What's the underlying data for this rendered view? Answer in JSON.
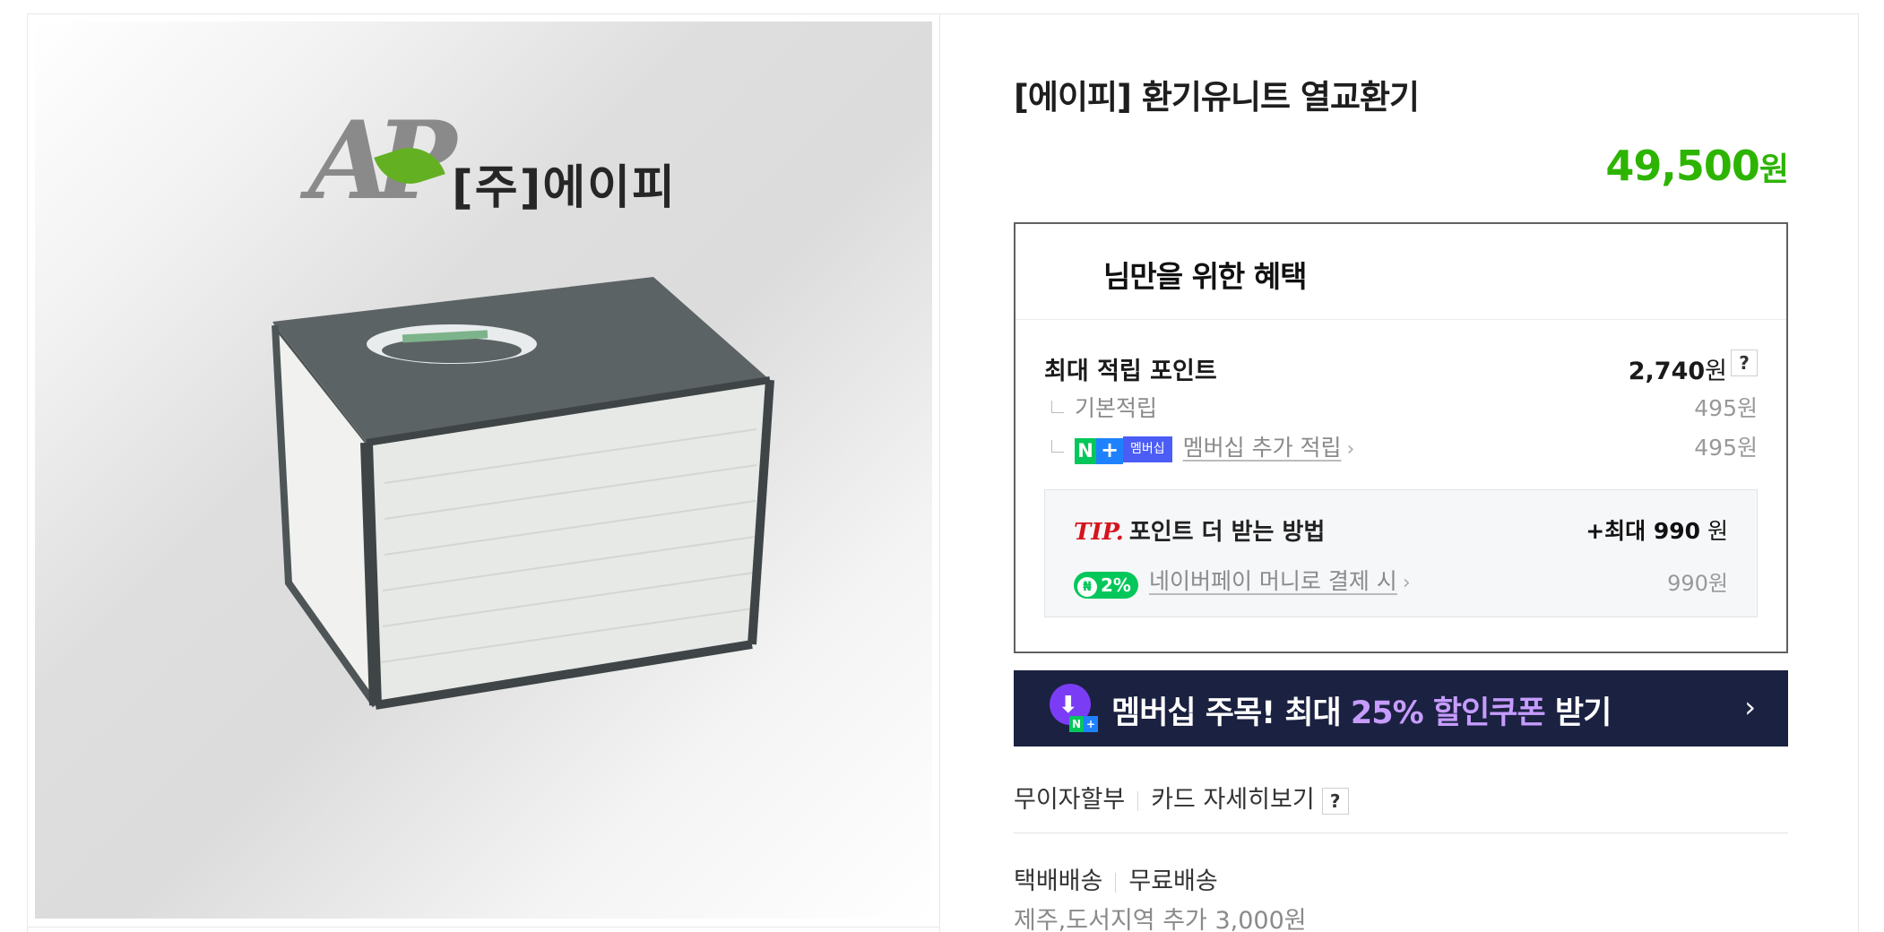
{
  "product": {
    "image_logo": "[주]에이피",
    "title": "[에이피] 환기유니트 열교환기",
    "price": "49,500",
    "price_unit": "원"
  },
  "benefits": {
    "header": "님만을 위한 혜택",
    "max_points_label": "최대 적립 포인트",
    "max_points_value": "2,740",
    "max_points_unit": "원",
    "help": "?",
    "basic_label": "기본적립",
    "basic_value": "495원",
    "membership_badge_n": "N",
    "membership_badge_plus": "+",
    "membership_badge_text": "멤버십",
    "membership_label": "멤버십 추가 적립",
    "membership_value": "495원",
    "tip": {
      "label": "TIP.",
      "text": "포인트 더 받는 방법",
      "max_prefix": "+최대 ",
      "max_value": "990",
      "max_unit": " 원",
      "badge_coin": "₦",
      "badge_pct": "2%",
      "npay_label": "네이버페이 머니로 결제 시",
      "npay_value": "990원"
    }
  },
  "coupon": {
    "text_before": "멤버십 주목! 최대 ",
    "highlight": "25% 할인쿠폰",
    "text_after": " 받기",
    "badge_n": "N",
    "badge_plus": "+"
  },
  "payment": {
    "installment": "무이자할부",
    "card_details": "카드 자세히보기",
    "help": "?"
  },
  "shipping": {
    "method": "택배배송",
    "fee": "무료배송",
    "extra": "제주,도서지역 추가 3,000원"
  },
  "colors": {
    "price_green": "#2db400",
    "coupon_bg": "#1b2140",
    "coupon_highlight": "#c69cff",
    "tip_red": "#d6141e",
    "naver_green": "#03c75a"
  }
}
